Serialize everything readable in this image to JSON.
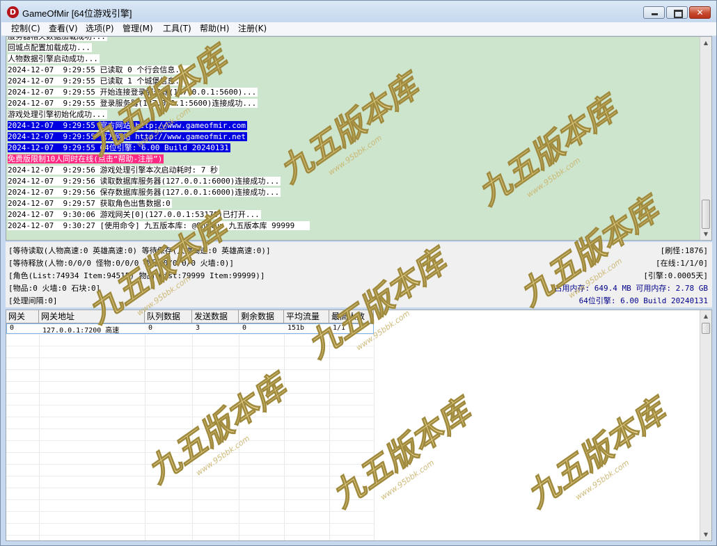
{
  "window": {
    "title": "GameOfMir [64位游戏引擎]",
    "icon_letter": "D",
    "close_glyph": "✕"
  },
  "menu": [
    "控制(C)",
    "查看(V)",
    "选项(P)",
    "管理(M)",
    "工具(T)",
    "帮助(H)",
    "注册(K)"
  ],
  "log": [
    {
      "text": "服务器相关数据加载成功...",
      "style": "normal"
    },
    {
      "text": "回城点配置加载成功...",
      "style": "normal"
    },
    {
      "text": "人物数据引擎启动成功...",
      "style": "normal"
    },
    {
      "text": "2024-12-07  9:29:55 已读取 0 个行会信息...",
      "style": "normal"
    },
    {
      "text": "2024-12-07  9:29:55 已读取 1 个城堡信息...",
      "style": "normal"
    },
    {
      "text": "2024-12-07  9:29:55 开始连接登录服务器(127.0.0.1:5600)...",
      "style": "normal"
    },
    {
      "text": "2024-12-07  9:29:55 登录服务器(127.0.0.1:5600)连接成功...",
      "style": "normal"
    },
    {
      "text": "游戏处理引擎初始化成功...",
      "style": "normal"
    },
    {
      "text": "2024-12-07  9:29:55 官方网站 http://www.gameofmir.com",
      "style": "highlight"
    },
    {
      "text": "2024-12-07  9:29:55 官方网站 http://www.gameofmir.net",
      "style": "highlight"
    },
    {
      "text": "2024-12-07  9:29:55 64位引擎: 6.00 Build 20240131",
      "style": "highlight"
    },
    {
      "text": "免费版限制10人同时在线(点击“帮助-注册”)",
      "style": "warn"
    },
    {
      "text": "2024-12-07  9:29:56 游戏处理引擎本次启动耗时: 7 秒",
      "style": "normal"
    },
    {
      "text": "2024-12-07  9:29:56 读取数据库服务器(127.0.0.1:6000)连接成功...",
      "style": "normal"
    },
    {
      "text": "2024-12-07  9:29:56 保存数据库服务器(127.0.0.1:6000)连接成功...",
      "style": "normal"
    },
    {
      "text": "2024-12-07  9:29:57 获取角色出售数据:0",
      "style": "normal"
    },
    {
      "text": "2024-12-07  9:30:06 游戏网关[0](127.0.0.1:53170)已打开...",
      "style": "normal"
    },
    {
      "text": "2024-12-07  9:30:27 [使用命令] 九五版本库: @Shutup 九五版本库 99999   ",
      "style": "normal"
    }
  ],
  "status": {
    "wait_read": "[等待读取(人物高速:0 英雄高速:0) 等待保存(人物高速:0 英雄高速:0)]",
    "wait_release": "[等待释放(人物:0/0/0 怪物:0/0/0 物品:0/0/0/0 火墙:0)]",
    "roles": "[角色(List:74934 Item:94515) 物品(List:79999 Item:99999)]",
    "items": "[物品:0 火墙:0 石块:0]",
    "interval": "[处理间隔:0]",
    "refresh": "[刷怪:1876]",
    "online": "[在线:1/1/0]",
    "engine_time": "[引擎:0.0005天]",
    "memory": "占用内存: 649.4 MB 可用内存: 2.78 GB",
    "build": "64位引擎: 6.00 Build 20240131"
  },
  "gateway_table": {
    "columns": [
      "网关",
      "网关地址",
      "队列数据",
      "发送数据",
      "剩余数据",
      "平均流量",
      "最高人数"
    ],
    "rows": [
      [
        "0",
        "127.0.0.1:7200 高速",
        "0",
        "3",
        "0",
        "151b",
        "1/1"
      ]
    ]
  },
  "watermark": {
    "text": "九五版本库",
    "url": "www.95bbk.com"
  }
}
